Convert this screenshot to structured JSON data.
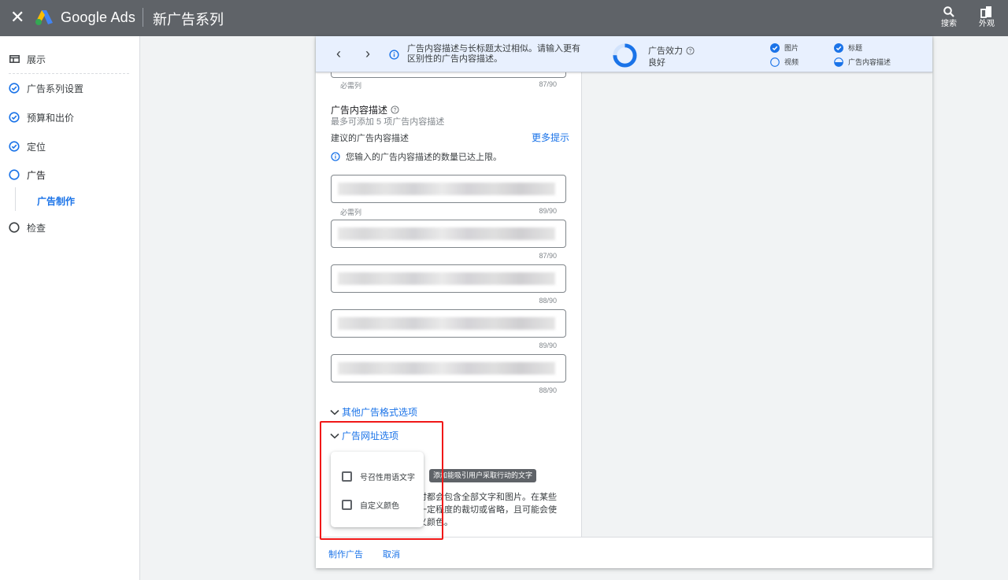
{
  "topbar": {
    "close_icon": "close-icon",
    "brand": "Google Ads",
    "campaign_title": "新广告系列",
    "tools": [
      {
        "label": "搜索",
        "icon": "search-icon"
      },
      {
        "label": "外观",
        "icon": "appearance-icon"
      }
    ]
  },
  "sidebar": {
    "items": [
      {
        "label": "展示",
        "icon": "display-icon",
        "state": "header"
      },
      {
        "label": "广告系列设置",
        "icon": "check-circle-icon",
        "state": "done"
      },
      {
        "label": "预算和出价",
        "icon": "check-circle-icon",
        "state": "done"
      },
      {
        "label": "定位",
        "icon": "check-circle-icon",
        "state": "done"
      },
      {
        "label": "广告",
        "icon": "circle-icon",
        "state": "current"
      },
      {
        "label": "检查",
        "icon": "circle-icon",
        "state": "todo"
      }
    ],
    "sub_item": "广告制作"
  },
  "banner": {
    "message": "广告内容描述与长标题太过相似。请输入更有区别性的广告内容描述。",
    "strength_label": "广告效力",
    "strength_value": "良好",
    "strength_fraction": 0.75,
    "checklist": [
      {
        "label": "图片",
        "status": "done"
      },
      {
        "label": "标题",
        "status": "done"
      },
      {
        "label": "视频",
        "status": "empty"
      },
      {
        "label": "广告内容描述",
        "status": "partial"
      }
    ],
    "accent": "#1a73e8"
  },
  "form": {
    "prev_field": {
      "required": "必需列",
      "count": "87/90"
    },
    "descriptions": {
      "title": "广告内容描述",
      "subtitle": "最多可添加 5 项广告内容描述",
      "suggested": "建议的广告内容描述",
      "more_tips": "更多提示",
      "limit_notice": "您输入的广告内容描述的数量已达上限。",
      "fields": [
        {
          "required": "必需列",
          "count": "89/90"
        },
        {
          "required": "",
          "count": "87/90"
        },
        {
          "required": "",
          "count": "88/90"
        },
        {
          "required": "",
          "count": "89/90"
        },
        {
          "required": "",
          "count": "88/90"
        }
      ]
    },
    "other_formats": "其他广告格式选项",
    "url_options": "广告网址选项",
    "description_text": "时都会包含全部文字和图片。在某些一定程度的裁切或省略，且可能会使义颜色。",
    "desc_lines": [
      "时都会包含全部文字和图片。在某些",
      "一定程度的裁切或省略，且可能会使",
      "义颜色。"
    ]
  },
  "popup": {
    "options": [
      {
        "label": "号召性用语文字",
        "checked": false
      },
      {
        "label": "自定义颜色",
        "checked": false
      }
    ],
    "tooltip": "添加能吸引用户采取行动的文字"
  },
  "footer": {
    "create": "制作广告",
    "cancel": "取消"
  },
  "colors": {
    "topbar": "#5f6368",
    "accent": "#1a73e8",
    "highlight_box": "#f01818"
  }
}
